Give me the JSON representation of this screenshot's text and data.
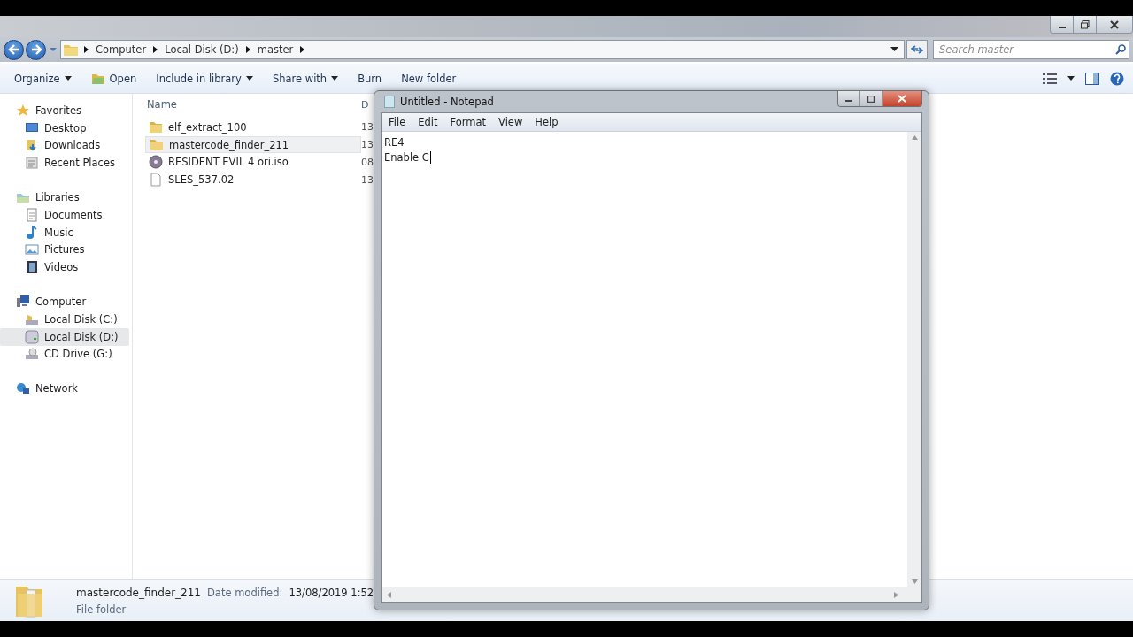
{
  "explorer": {
    "breadcrumb": [
      "Computer",
      "Local Disk (D:)",
      "master"
    ],
    "search": {
      "placeholder": "Search master"
    },
    "toolbar": [
      {
        "label": "Organize",
        "dropdown": true,
        "kind": "plain"
      },
      {
        "label": "Open",
        "dropdown": false,
        "kind": "open"
      },
      {
        "label": "Include in library",
        "dropdown": true,
        "kind": "plain"
      },
      {
        "label": "Share with",
        "dropdown": true,
        "kind": "plain"
      },
      {
        "label": "Burn",
        "dropdown": false,
        "kind": "plain"
      },
      {
        "label": "New folder",
        "dropdown": false,
        "kind": "plain"
      }
    ],
    "sidebar": {
      "groups": [
        {
          "label": "Favorites",
          "kind": "star",
          "children": [
            {
              "label": "Desktop",
              "kind": "desktop",
              "selected": false
            },
            {
              "label": "Downloads",
              "kind": "downloads",
              "selected": false
            },
            {
              "label": "Recent Places",
              "kind": "recent",
              "selected": false
            }
          ]
        },
        {
          "label": "Libraries",
          "kind": "library",
          "children": [
            {
              "label": "Documents",
              "kind": "document",
              "selected": false
            },
            {
              "label": "Music",
              "kind": "music",
              "selected": false
            },
            {
              "label": "Pictures",
              "kind": "pictures",
              "selected": false
            },
            {
              "label": "Videos",
              "kind": "videos",
              "selected": false
            }
          ]
        },
        {
          "label": "Computer",
          "kind": "computer",
          "children": [
            {
              "label": "Local Disk (C:)",
              "kind": "disk",
              "selected": false
            },
            {
              "label": "Local Disk (D:)",
              "kind": "drive",
              "selected": true
            },
            {
              "label": "CD Drive (G:)",
              "kind": "cd",
              "selected": false
            }
          ]
        },
        {
          "label": "Network",
          "kind": "network"
        }
      ]
    },
    "file_list": {
      "columns": [
        "Name",
        "D"
      ],
      "rows": [
        {
          "name": "elf_extract_100",
          "column_2": "13",
          "kind": "folder",
          "selected": false
        },
        {
          "name": "mastercode_finder_211",
          "column_2": "13",
          "kind": "folder",
          "selected": true
        },
        {
          "name": "RESIDENT EVIL 4 ori.iso",
          "column_2": "08",
          "kind": "disc",
          "selected": false
        },
        {
          "name": "SLES_537.02",
          "column_2": "13",
          "kind": "file",
          "selected": false
        }
      ]
    },
    "details_pane": {
      "name": "mastercode_finder_211",
      "date_label": "Date modified:",
      "date_value": "13/08/2019 1:52",
      "type": "File folder"
    }
  },
  "notepad": {
    "title": "Untitled - Notepad",
    "menu": [
      "File",
      "Edit",
      "Format",
      "View",
      "Help"
    ],
    "lines": [
      "RE4",
      "Enable C"
    ]
  }
}
